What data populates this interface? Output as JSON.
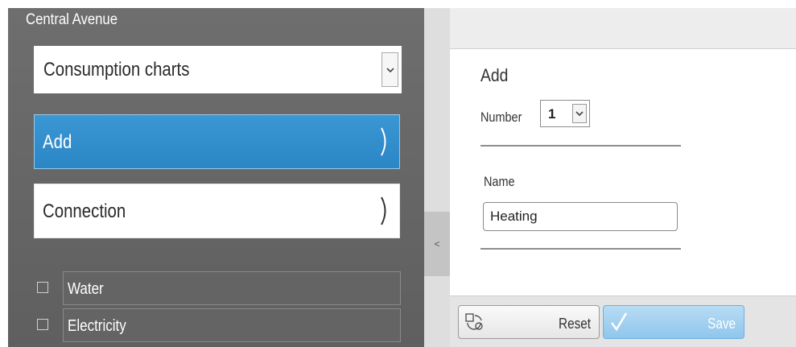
{
  "sidebar": {
    "title": "Central Avenue",
    "view_select": {
      "value": "Consumption charts",
      "icon": "chevron-down-icon"
    },
    "nav": [
      {
        "label": "Add",
        "active": true,
        "icon": "chevron-right-icon"
      },
      {
        "label": "Connection",
        "active": false,
        "icon": "chevron-right-icon"
      }
    ],
    "items": [
      {
        "label": "Water",
        "checked": false
      },
      {
        "label": "Electricity",
        "checked": false
      }
    ],
    "collapse_icon": "<"
  },
  "form": {
    "heading": "Add",
    "number_label": "Number",
    "number_value": "1",
    "name_label": "Name",
    "name_value": "Heating"
  },
  "footer": {
    "reset_label": "Reset",
    "save_label": "Save",
    "reset_icon": "reset-icon",
    "save_icon": "checkmark-icon"
  },
  "colors": {
    "accent": "#2a86c4",
    "sidebar_bg": "#666666",
    "save_bg": "#a3d0f0"
  }
}
